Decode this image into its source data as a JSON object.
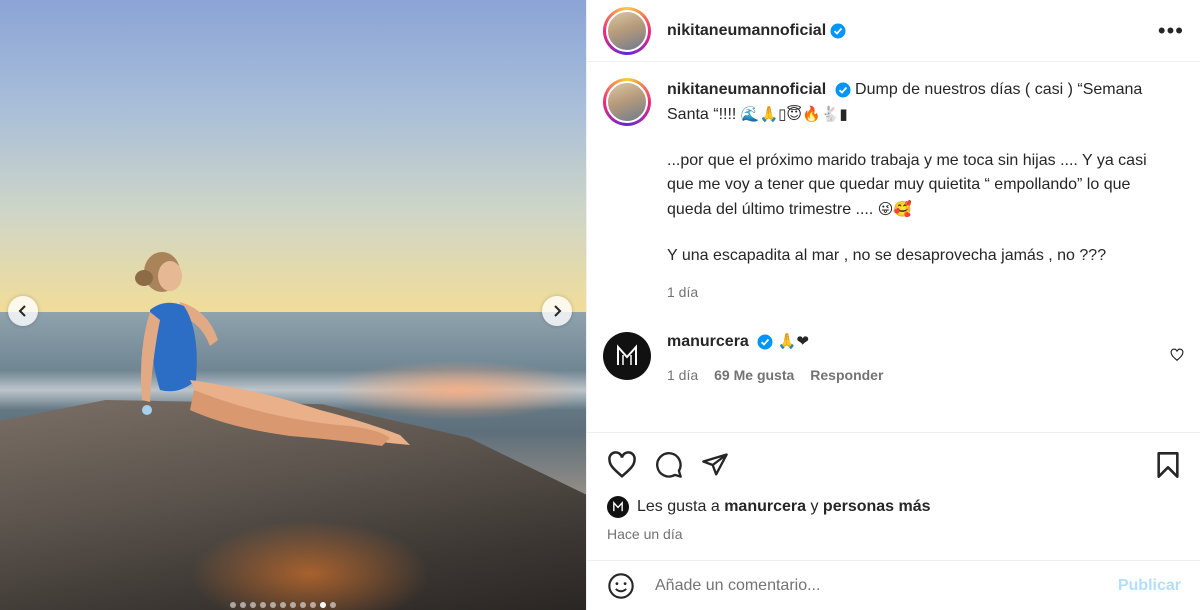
{
  "post": {
    "username": "nikitaneumannoficial",
    "caption_line1": "Dump de nuestros días ( casi ) “Semana Santa “!!!!",
    "caption_emojis": "🌊🙏▯😇🔥🐇▮",
    "caption_para2": "...por que el próximo marido trabaja y me toca sin hijas .... Y ya casi que me voy a tener que quedar muy quietita “ empollando” lo que queda del último trimestre ....",
    "caption_para2_emojis": "😜🥰",
    "caption_para3": "Y una escapadita al mar , no se desaprovecha jamás , no ???",
    "caption_time": "1 día"
  },
  "comment": {
    "username": "manurcera",
    "emojis": "🙏❤",
    "time": "1 día",
    "likes": "69 Me gusta",
    "reply": "Responder"
  },
  "likes_row": {
    "prefix": "Les gusta a",
    "user": "manurcera",
    "connector": "y",
    "rest": "personas más"
  },
  "timestamp": "Hace un día",
  "add_comment": {
    "placeholder": "Añade un comentario...",
    "post_label": "Publicar"
  },
  "colors": {
    "verified": "#0095f6",
    "heart": "#ed4956",
    "post_disabled": "#b2dffc"
  }
}
